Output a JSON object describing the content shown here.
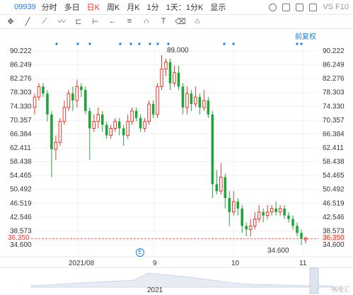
{
  "toolbar": {
    "code": "09939",
    "items": [
      "分时",
      "多日",
      "日K",
      "周K",
      "月K",
      "1分",
      "1天：1分K",
      "显示"
    ],
    "active": "日K",
    "right_text": "VS F10"
  },
  "chart_data": {
    "type": "candlestick",
    "title": "",
    "annotation_label": "前复权",
    "y_ticks": [
      "90.222",
      "86.249",
      "82.276",
      "78.303",
      "74.330",
      "70.357",
      "66.384",
      "62.411",
      "58.438",
      "54.465",
      "50.492",
      "46.519",
      "42.546",
      "38.573",
      "36.350",
      "34.600"
    ],
    "current_price": "36.350",
    "x_ticks": [
      "2021/08",
      "9",
      "10",
      "11"
    ],
    "year_label": "2021",
    "max_label": "89.000",
    "min_label": "34.600",
    "ylim": [
      34.6,
      90.222
    ],
    "candles": [
      {
        "o": 74,
        "c": 77,
        "h": 78,
        "l": 72
      },
      {
        "o": 77,
        "c": 80,
        "h": 81,
        "l": 76
      },
      {
        "o": 80,
        "c": 78,
        "h": 81,
        "l": 77
      },
      {
        "o": 78,
        "c": 72,
        "h": 79,
        "l": 70
      },
      {
        "o": 72,
        "c": 62,
        "h": 73,
        "l": 54
      },
      {
        "o": 62,
        "c": 64,
        "h": 66,
        "l": 59
      },
      {
        "o": 64,
        "c": 70,
        "h": 71,
        "l": 63
      },
      {
        "o": 70,
        "c": 74,
        "h": 76,
        "l": 69
      },
      {
        "o": 74,
        "c": 78,
        "h": 79,
        "l": 73
      },
      {
        "o": 78,
        "c": 76,
        "h": 80,
        "l": 73
      },
      {
        "o": 76,
        "c": 80,
        "h": 82,
        "l": 74
      },
      {
        "o": 80,
        "c": 79,
        "h": 81,
        "l": 77
      },
      {
        "o": 79,
        "c": 73,
        "h": 80,
        "l": 72
      },
      {
        "o": 73,
        "c": 68,
        "h": 74,
        "l": 59
      },
      {
        "o": 68,
        "c": 70,
        "h": 72,
        "l": 67
      },
      {
        "o": 70,
        "c": 72,
        "h": 74,
        "l": 68
      },
      {
        "o": 72,
        "c": 69,
        "h": 73,
        "l": 67
      },
      {
        "o": 69,
        "c": 66,
        "h": 70,
        "l": 65
      },
      {
        "o": 66,
        "c": 68,
        "h": 69,
        "l": 65
      },
      {
        "o": 68,
        "c": 70,
        "h": 71,
        "l": 67
      },
      {
        "o": 70,
        "c": 68,
        "h": 71,
        "l": 66
      },
      {
        "o": 68,
        "c": 66,
        "h": 69,
        "l": 63
      },
      {
        "o": 66,
        "c": 70,
        "h": 72,
        "l": 65
      },
      {
        "o": 70,
        "c": 73,
        "h": 74,
        "l": 69
      },
      {
        "o": 73,
        "c": 71,
        "h": 74,
        "l": 70
      },
      {
        "o": 71,
        "c": 68,
        "h": 72,
        "l": 67
      },
      {
        "o": 68,
        "c": 70,
        "h": 71,
        "l": 67
      },
      {
        "o": 70,
        "c": 75,
        "h": 76,
        "l": 69
      },
      {
        "o": 75,
        "c": 72,
        "h": 76,
        "l": 71
      },
      {
        "o": 72,
        "c": 80,
        "h": 81,
        "l": 71
      },
      {
        "o": 80,
        "c": 85,
        "h": 89,
        "l": 79
      },
      {
        "o": 85,
        "c": 87,
        "h": 88,
        "l": 83
      },
      {
        "o": 87,
        "c": 81,
        "h": 88,
        "l": 79
      },
      {
        "o": 81,
        "c": 84,
        "h": 86,
        "l": 80
      },
      {
        "o": 84,
        "c": 80,
        "h": 86,
        "l": 79
      },
      {
        "o": 80,
        "c": 74,
        "h": 81,
        "l": 72
      },
      {
        "o": 74,
        "c": 78,
        "h": 80,
        "l": 72
      },
      {
        "o": 78,
        "c": 75,
        "h": 79,
        "l": 73
      },
      {
        "o": 75,
        "c": 77,
        "h": 80,
        "l": 74
      },
      {
        "o": 77,
        "c": 74,
        "h": 78,
        "l": 72
      },
      {
        "o": 74,
        "c": 76,
        "h": 79,
        "l": 73
      },
      {
        "o": 76,
        "c": 72,
        "h": 77,
        "l": 71
      },
      {
        "o": 72,
        "c": 52,
        "h": 73,
        "l": 48
      },
      {
        "o": 52,
        "c": 50,
        "h": 56,
        "l": 49
      },
      {
        "o": 50,
        "c": 54,
        "h": 58,
        "l": 49
      },
      {
        "o": 54,
        "c": 48,
        "h": 55,
        "l": 45
      },
      {
        "o": 48,
        "c": 44,
        "h": 50,
        "l": 40
      },
      {
        "o": 44,
        "c": 47,
        "h": 50,
        "l": 43
      },
      {
        "o": 47,
        "c": 45,
        "h": 48,
        "l": 43
      },
      {
        "o": 45,
        "c": 40,
        "h": 46,
        "l": 38
      },
      {
        "o": 40,
        "c": 39,
        "h": 41,
        "l": 37
      },
      {
        "o": 39,
        "c": 40,
        "h": 42,
        "l": 37
      },
      {
        "o": 40,
        "c": 42,
        "h": 44,
        "l": 39
      },
      {
        "o": 42,
        "c": 44,
        "h": 46,
        "l": 41
      },
      {
        "o": 44,
        "c": 43,
        "h": 45,
        "l": 41
      },
      {
        "o": 43,
        "c": 44,
        "h": 46,
        "l": 42
      },
      {
        "o": 44,
        "c": 45,
        "h": 46,
        "l": 43
      },
      {
        "o": 45,
        "c": 44,
        "h": 47,
        "l": 43
      },
      {
        "o": 44,
        "c": 45,
        "h": 46,
        "l": 43
      },
      {
        "o": 45,
        "c": 43,
        "h": 46,
        "l": 42
      },
      {
        "o": 43,
        "c": 42,
        "h": 44,
        "l": 41
      },
      {
        "o": 42,
        "c": 40,
        "h": 43,
        "l": 39
      },
      {
        "o": 40,
        "c": 38,
        "h": 41,
        "l": 37
      },
      {
        "o": 38,
        "c": 36.35,
        "h": 39,
        "l": 34.6
      },
      {
        "o": 36,
        "c": 36.5,
        "h": 37,
        "l": 35
      }
    ],
    "colors": {
      "up": "#e0392b",
      "down": "#1fa53b",
      "dots": "#1e7bd6",
      "area": "#e7ecf4"
    },
    "grid": true
  },
  "watermark": "格隆汇"
}
